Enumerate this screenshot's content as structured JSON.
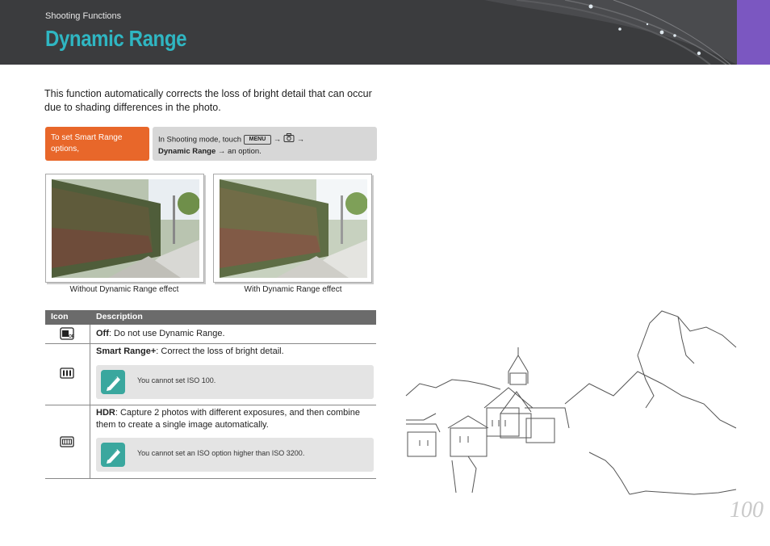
{
  "header": {
    "section": "Shooting Functions",
    "title": "Dynamic Range"
  },
  "intro": "This function automatically corrects the loss of bright detail that can occur due to shading differences in the photo.",
  "howto": {
    "label": "To set Smart Range options,",
    "prefix": "In Shooting mode, touch",
    "menu_key": "MENU",
    "arrow": "→",
    "camera_icon": "camera-icon",
    "option": "Dynamic Range",
    "suffix": "→ an option."
  },
  "photos": [
    {
      "caption": "Without Dynamic Range effect"
    },
    {
      "caption": "With Dynamic Range effect"
    }
  ],
  "table": {
    "head_icon": "Icon",
    "head_desc": "Description",
    "rows": [
      {
        "icon": "dr-off-icon",
        "term": "Off",
        "text": ": Do not use Dynamic Range."
      },
      {
        "icon": "smart-range-icon",
        "term": "Smart Range+",
        "text": ": Correct the loss of bright detail.",
        "note": "You cannot set ISO 100."
      },
      {
        "icon": "hdr-icon",
        "term": "HDR",
        "text": ": Capture 2 photos with different exposures, and then combine them to create a single image automatically.",
        "note": "You cannot set an ISO option higher than ISO 3200."
      }
    ]
  },
  "page_number": "100",
  "colors": {
    "header_bg": "#3b3c3e",
    "title": "#2fb6c2",
    "tab": "#7b57c1",
    "howto_label": "#e8672a",
    "note_icon": "#3aa79e"
  }
}
